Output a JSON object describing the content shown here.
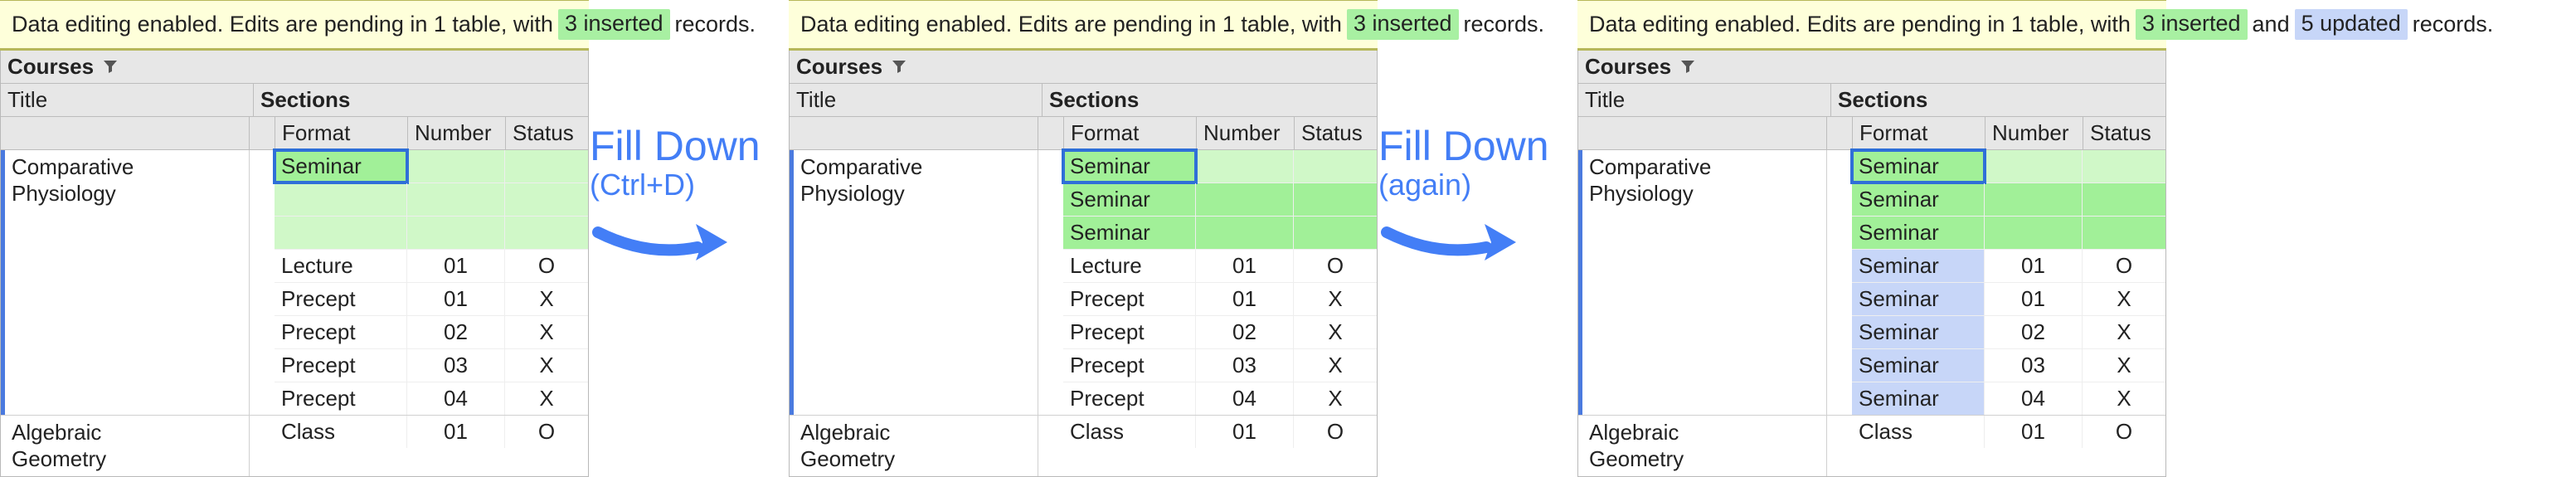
{
  "notice": {
    "prefix": "Data editing enabled. Edits are pending in 1 table, with",
    "inserted": "3 inserted",
    "and": "and",
    "updated": "5 updated",
    "suffix": "records."
  },
  "arrows": [
    {
      "line1": "Fill Down",
      "line2": "(Ctrl+D)"
    },
    {
      "line1": "Fill Down",
      "line2": "(again)"
    }
  ],
  "headers": {
    "courses": "Courses",
    "title": "Title",
    "sections": "Sections",
    "format": "Format",
    "number": "Number",
    "status": "Status"
  },
  "panels": [
    {
      "noticeHasUpdated": false,
      "rows": [
        {
          "title": "Comparative Physiology",
          "stripe": true,
          "sections": [
            {
              "format": "Seminar",
              "number": "",
              "status": "",
              "cls": "ins selected"
            },
            {
              "format": "",
              "number": "",
              "status": "",
              "cls": "ins"
            },
            {
              "format": "",
              "number": "",
              "status": "",
              "cls": "ins"
            },
            {
              "format": "Lecture",
              "number": "01",
              "status": "O",
              "cls": ""
            },
            {
              "format": "Precept",
              "number": "01",
              "status": "X",
              "cls": ""
            },
            {
              "format": "Precept",
              "number": "02",
              "status": "X",
              "cls": ""
            },
            {
              "format": "Precept",
              "number": "03",
              "status": "X",
              "cls": ""
            },
            {
              "format": "Precept",
              "number": "04",
              "status": "X",
              "cls": ""
            }
          ]
        },
        {
          "title": "Algebraic Geometry",
          "stripe": false,
          "sections": [
            {
              "format": "Class",
              "number": "01",
              "status": "O",
              "cls": ""
            }
          ]
        }
      ]
    },
    {
      "noticeHasUpdated": false,
      "rows": [
        {
          "title": "Comparative Physiology",
          "stripe": true,
          "sections": [
            {
              "format": "Seminar",
              "number": "",
              "status": "",
              "cls": "ins selected"
            },
            {
              "format": "Seminar",
              "number": "",
              "status": "",
              "cls": "insBright"
            },
            {
              "format": "Seminar",
              "number": "",
              "status": "",
              "cls": "insBright"
            },
            {
              "format": "Lecture",
              "number": "01",
              "status": "O",
              "cls": ""
            },
            {
              "format": "Precept",
              "number": "01",
              "status": "X",
              "cls": ""
            },
            {
              "format": "Precept",
              "number": "02",
              "status": "X",
              "cls": ""
            },
            {
              "format": "Precept",
              "number": "03",
              "status": "X",
              "cls": ""
            },
            {
              "format": "Precept",
              "number": "04",
              "status": "X",
              "cls": ""
            }
          ]
        },
        {
          "title": "Algebraic Geometry",
          "stripe": false,
          "sections": [
            {
              "format": "Class",
              "number": "01",
              "status": "O",
              "cls": ""
            }
          ]
        }
      ]
    },
    {
      "noticeHasUpdated": true,
      "rows": [
        {
          "title": "Comparative Physiology",
          "stripe": true,
          "sections": [
            {
              "format": "Seminar",
              "number": "",
              "status": "",
              "cls": "ins selected"
            },
            {
              "format": "Seminar",
              "number": "",
              "status": "",
              "cls": "insBright"
            },
            {
              "format": "Seminar",
              "number": "",
              "status": "",
              "cls": "insBright"
            },
            {
              "format": "Seminar",
              "number": "01",
              "status": "O",
              "cls": "upd"
            },
            {
              "format": "Seminar",
              "number": "01",
              "status": "X",
              "cls": "upd"
            },
            {
              "format": "Seminar",
              "number": "02",
              "status": "X",
              "cls": "upd"
            },
            {
              "format": "Seminar",
              "number": "03",
              "status": "X",
              "cls": "upd"
            },
            {
              "format": "Seminar",
              "number": "04",
              "status": "X",
              "cls": "upd"
            }
          ]
        },
        {
          "title": "Algebraic Geometry",
          "stripe": false,
          "sections": [
            {
              "format": "Class",
              "number": "01",
              "status": "O",
              "cls": ""
            }
          ]
        }
      ]
    }
  ]
}
